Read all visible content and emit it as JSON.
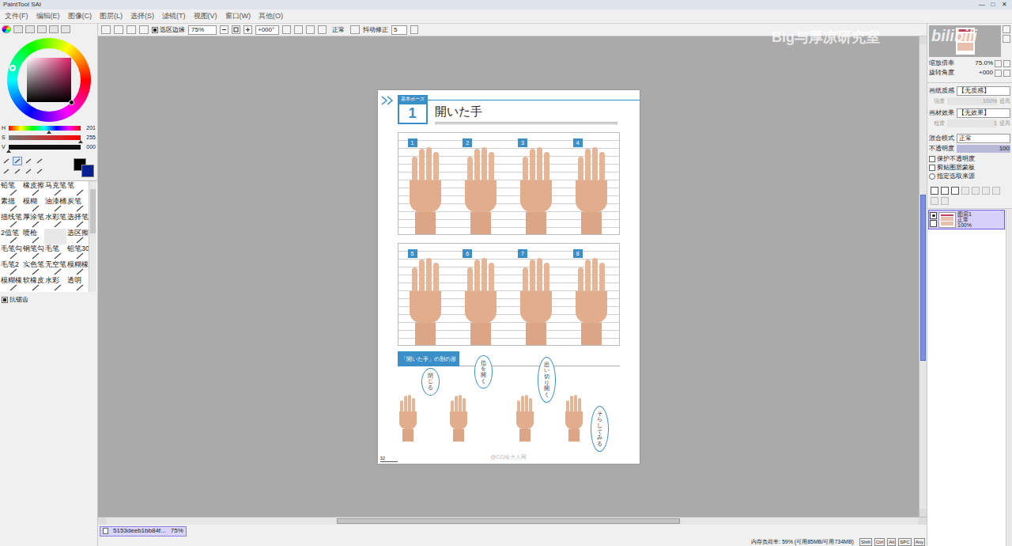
{
  "window": {
    "title": "PaintTool SAI",
    "controls": [
      "—",
      "□",
      "✕"
    ]
  },
  "menu": [
    "文件(F)",
    "编辑(E)",
    "图像(C)",
    "图层(L)",
    "选择(S)",
    "滤镜(T)",
    "视图(V)",
    "窗口(W)",
    "其他(O)"
  ],
  "color_panel": {
    "sliders": [
      {
        "label": "H",
        "value": "201",
        "level": 0.56
      },
      {
        "label": "S",
        "value": "255",
        "level": 1
      },
      {
        "label": "V",
        "value": "000",
        "level": 0
      }
    ],
    "primary_color": "#000000",
    "secondary_color": "#0a1f8f"
  },
  "brushes": [
    {
      "label": "铅笔",
      "kind": "tool",
      "selected": false
    },
    {
      "label": "橡皮擦",
      "kind": "tool",
      "selected": false
    },
    {
      "label": "马克笔",
      "kind": "tool",
      "selected": false
    },
    {
      "label": "笔",
      "kind": "tool",
      "selected": false
    },
    {
      "label": "素描",
      "kind": "tool",
      "selected": false
    },
    {
      "label": "模糊",
      "kind": "tool",
      "selected": false
    },
    {
      "label": "油漆桶",
      "kind": "tool",
      "selected": false
    },
    {
      "label": "炭笔",
      "kind": "tool",
      "selected": false
    },
    {
      "label": "描线笔",
      "kind": "tool",
      "selected": false
    },
    {
      "label": "厚涂笔",
      "kind": "tool",
      "selected": false
    },
    {
      "label": "水彩笔",
      "kind": "tool",
      "selected": false
    },
    {
      "label": "选择笔",
      "kind": "tool",
      "selected": false
    },
    {
      "label": "2值笔",
      "kind": "tool",
      "selected": false
    },
    {
      "label": "喷枪",
      "kind": "tool",
      "selected": false
    },
    {
      "label": "",
      "kind": "empty",
      "selected": false
    },
    {
      "label": "选区擦",
      "kind": "tool",
      "selected": false
    },
    {
      "label": "毛笔勾",
      "kind": "tool",
      "selected": false
    },
    {
      "label": "钢笔勾",
      "kind": "tool",
      "selected": false
    },
    {
      "label": "毛笔",
      "kind": "tool",
      "selected": false
    },
    {
      "label": "铅笔30",
      "kind": "tool",
      "selected": false
    },
    {
      "label": "毛笔2",
      "kind": "tool",
      "selected": false
    },
    {
      "label": "实色笔",
      "kind": "tool",
      "selected": false
    },
    {
      "label": "无空笔",
      "kind": "tool",
      "selected": false
    },
    {
      "label": "模糊橡",
      "kind": "tool",
      "selected": false
    },
    {
      "label": "模糊橡",
      "kind": "tool",
      "selected": false
    },
    {
      "label": "软橡皮",
      "kind": "tool",
      "selected": false
    },
    {
      "label": "水彩",
      "kind": "tool",
      "selected": false
    },
    {
      "label": "透明",
      "kind": "tool",
      "selected": false
    }
  ],
  "antialias": {
    "label": "抗锯齿",
    "checked": true
  },
  "toolbar": {
    "selection_edge": {
      "label": "选区边缘",
      "checked": true
    },
    "zoom": "75%",
    "rotation": "+000°",
    "blend": "正常",
    "stabilizer_label": "抖动修正",
    "stabilizer": "5"
  },
  "document": {
    "tab_label": "基本ポーズ",
    "number": "1",
    "title": "開いた手",
    "photo_sets": [
      [
        "1",
        "2",
        "3",
        "4"
      ],
      [
        "5",
        "6",
        "7",
        "8"
      ]
    ],
    "section": "「開いた手」の別の形",
    "bubbles": [
      "閉じる",
      "指を開く",
      "思い切り開く",
      "そらしてみる"
    ],
    "page_number": "32",
    "credit": "@CG绘大人网"
  },
  "navigator": {
    "zoom_label": "缩放倍率",
    "zoom": "75.0%",
    "angle_label": "旋转角度",
    "angle": "+000"
  },
  "properties": {
    "paper": {
      "label": "画纸质感",
      "value": "【无质感】",
      "sub_label": "强度",
      "sub_value": "100%",
      "sub_extra": "提高"
    },
    "effect": {
      "label": "画材效果",
      "value": "【无效果】",
      "sub_label": "程度",
      "sub_value": "1",
      "sub_extra": "提高"
    },
    "blend": {
      "label": "混合模式",
      "value": "正常"
    },
    "opacity": {
      "label": "不透明度",
      "value": "100"
    },
    "options": [
      {
        "label": "保护不透明度",
        "kind": "checkbox",
        "checked": false
      },
      {
        "label": "剪贴图层蒙板",
        "kind": "checkbox",
        "checked": false
      },
      {
        "label": "指定选取来源",
        "kind": "radio",
        "checked": false
      }
    ]
  },
  "layers": [
    {
      "name": "图层1",
      "mode": "正常",
      "opacity": "100%",
      "visible": true,
      "selected": true
    }
  ],
  "tab": {
    "name": "5153deeb1bb84f...",
    "zoom": "75%",
    "selected": true
  },
  "status": {
    "memory": "内存负荷率: 59% (可用85MB/可用734MB)",
    "keys": [
      "Shift",
      "Ctrl",
      "Alt",
      "SPC",
      "Any"
    ]
  },
  "watermark": {
    "text": "Big与厚凉研究室",
    "logo": "bilibili"
  }
}
